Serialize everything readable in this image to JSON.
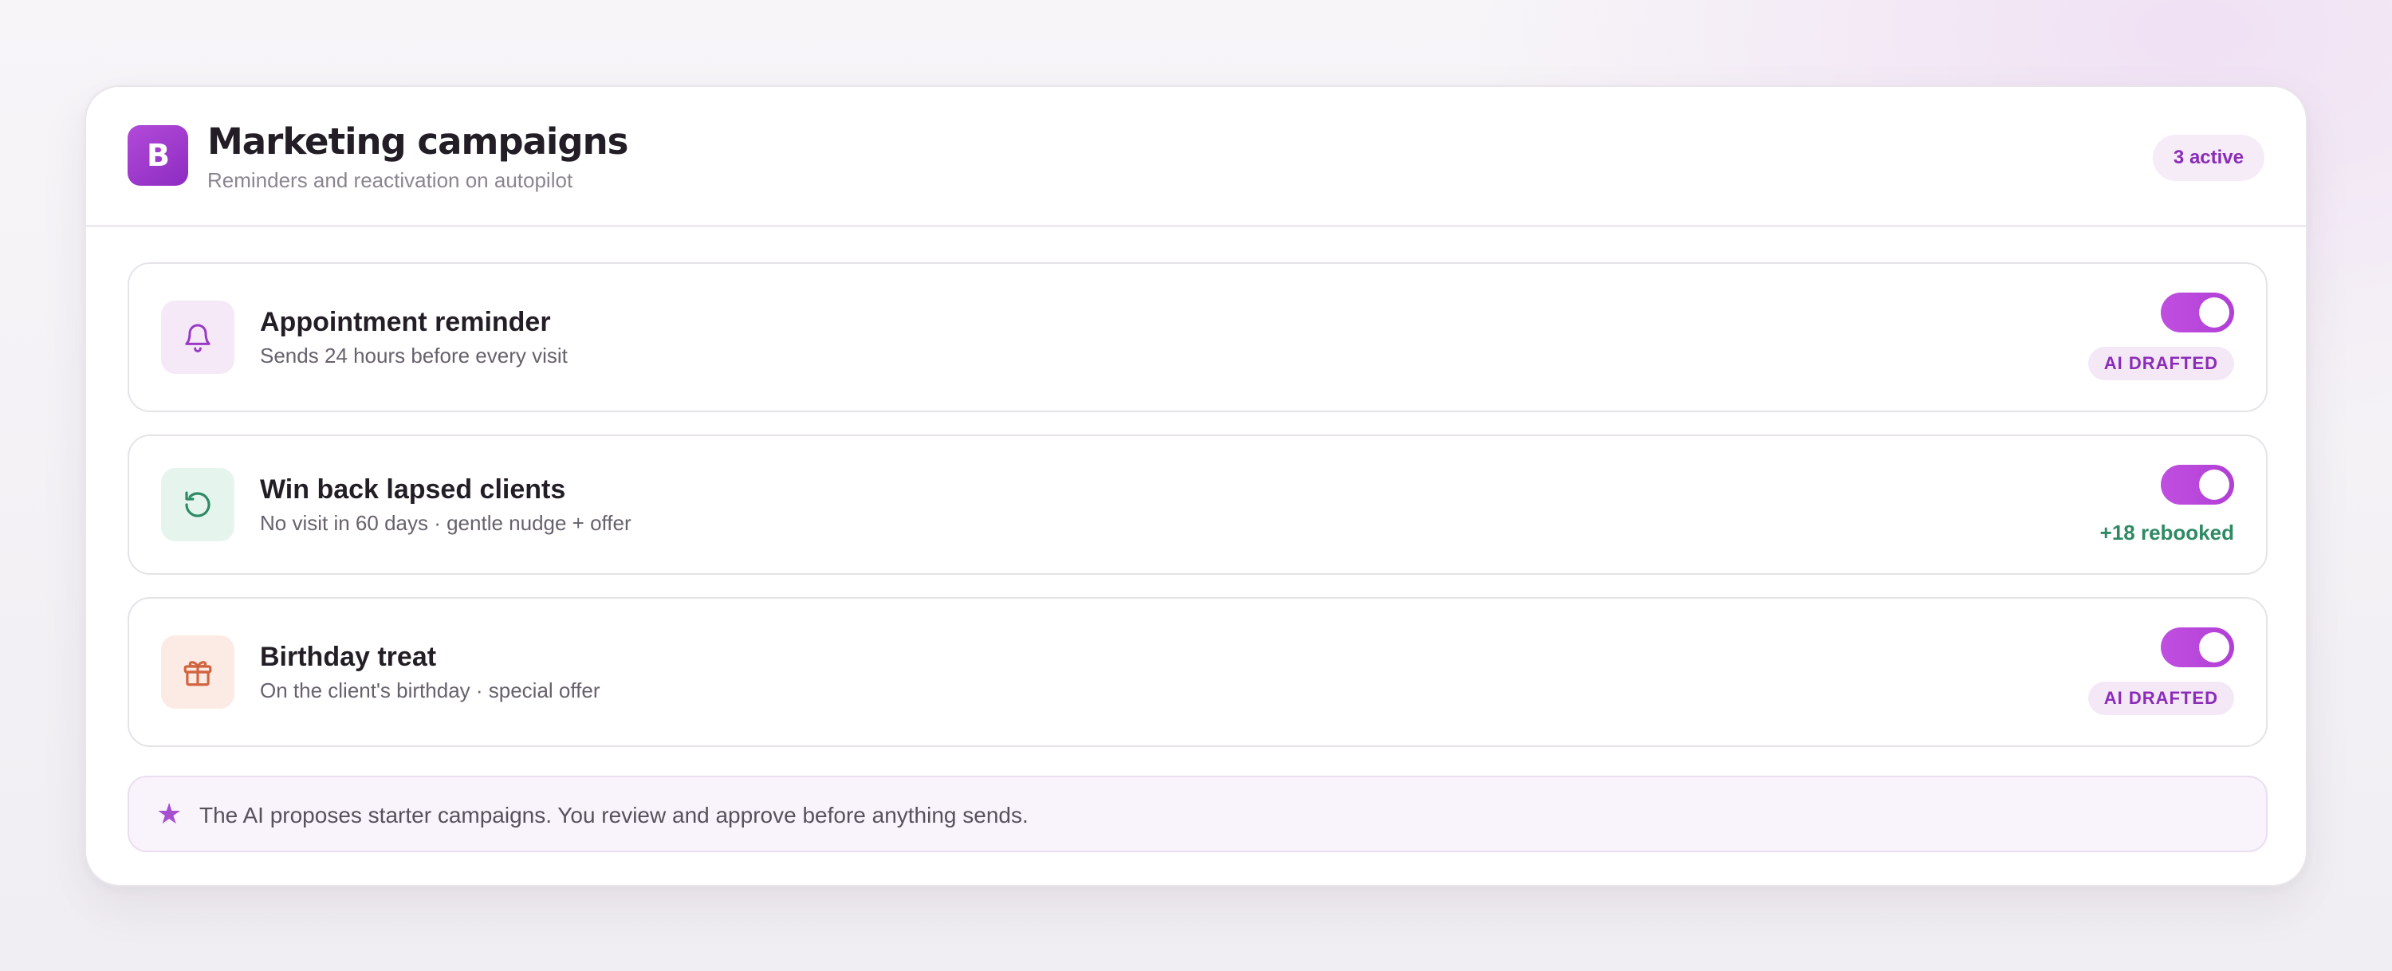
{
  "header": {
    "logo_letter": "B",
    "title": "Marketing campaigns",
    "subtitle": "Reminders and reactivation on autopilot",
    "active_badge": "3 active"
  },
  "campaigns": [
    {
      "icon": "bell-icon",
      "name": "Appointment reminder",
      "description": "Sends 24 hours before every visit",
      "enabled": true,
      "tag": "AI DRAFTED"
    },
    {
      "icon": "refresh-icon",
      "name": "Win back lapsed clients",
      "description": "No visit in 60 days · gentle nudge + offer",
      "enabled": true,
      "stat": "+18 rebooked"
    },
    {
      "icon": "gift-icon",
      "name": "Birthday treat",
      "description": "On the client's birthday · special offer",
      "enabled": true,
      "tag": "AI DRAFTED"
    }
  ],
  "footer": {
    "icon": "star-icon",
    "note": "The AI proposes starter campaigns. You review and approve before anything sends."
  },
  "colors": {
    "accent": "#b13fd6",
    "accent_text": "#8a2cb8",
    "success": "#2e8a64",
    "gift": "#d0643e"
  }
}
